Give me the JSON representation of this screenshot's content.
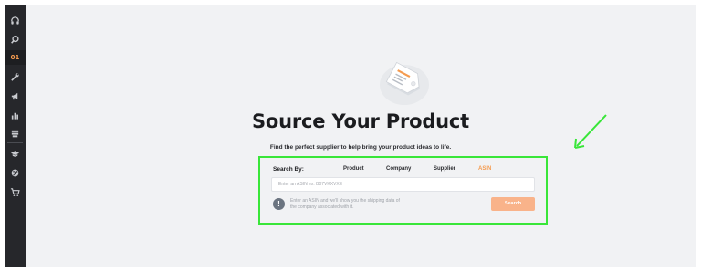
{
  "sidebar": {
    "items": [
      {
        "icon": "headset-icon"
      },
      {
        "icon": "search-icon"
      },
      {
        "icon": "source-product-icon",
        "label": "01",
        "active": true
      },
      {
        "icon": "wrench-icon"
      },
      {
        "icon": "megaphone-icon"
      },
      {
        "icon": "bar-chart-icon"
      },
      {
        "icon": "stack-icon"
      },
      {
        "icon": "graduation-cap-icon"
      },
      {
        "icon": "globe-icon"
      },
      {
        "icon": "cart-icon"
      }
    ]
  },
  "main": {
    "title": "Source Your Product",
    "subtitle": "Find the perfect supplier to help bring your product ideas to life.",
    "search": {
      "search_by_label": "Search By:",
      "tabs": [
        {
          "label": "Product"
        },
        {
          "label": "Company"
        },
        {
          "label": "Supplier"
        },
        {
          "label": "ASIN",
          "active": true
        }
      ],
      "input_placeholder": "Enter an ASIN ex: B07VKXVXE",
      "info_text": "Enter an ASIN and we'll show you the shipping data of the company associated with it.",
      "button_label": "Search"
    }
  },
  "colors": {
    "accent": "#f59b4f",
    "highlight": "#39e639",
    "sidebar_bg": "#26272b",
    "page_bg": "#f1f2f4"
  }
}
